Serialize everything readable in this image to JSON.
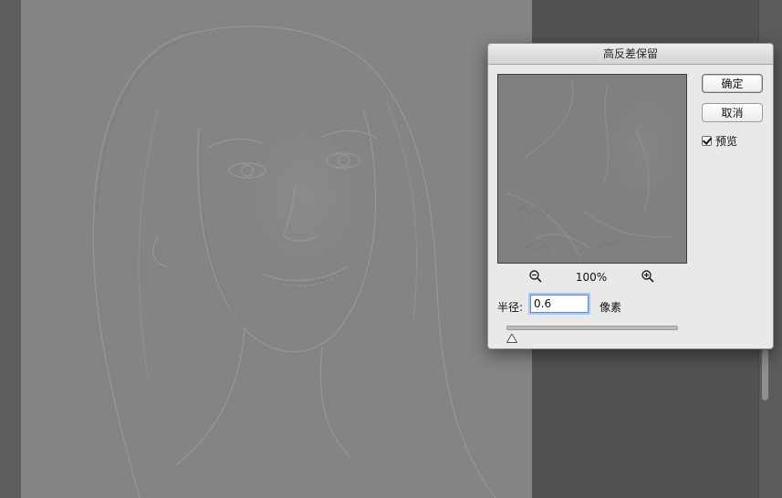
{
  "dialog": {
    "title": "高反差保留",
    "ok_label": "确定",
    "cancel_label": "取消",
    "preview_label": "预览",
    "preview_checked": true,
    "zoom_level": "100%",
    "radius_label": "半径:",
    "radius_value": "0.6",
    "unit_label": "像素",
    "slider_level": 0.02
  },
  "icons": {
    "zoom_out": "zoom-out-icon",
    "zoom_in": "zoom-in-icon",
    "slider_thumb": "slider-thumb-icon"
  },
  "colors": {
    "canvas": "#848484",
    "dialog_bg": "#e9e9e9",
    "focus_ring": "#a9c8f3"
  }
}
